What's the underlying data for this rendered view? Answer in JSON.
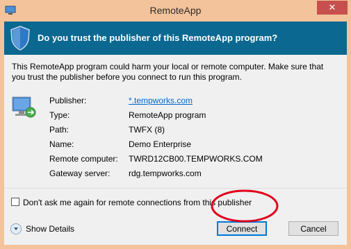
{
  "window": {
    "title": "RemoteApp",
    "close_glyph": "✕"
  },
  "banner": {
    "icon": "shield-icon",
    "text": "Do you trust the publisher of this RemoteApp program?"
  },
  "warning": "This RemoteApp program could harm your local or remote computer. Make sure that you trust the publisher before you connect to run this program.",
  "details": [
    {
      "label": "Publisher:",
      "value": "*.tempworks.com",
      "link": true
    },
    {
      "label": "Type:",
      "value": "RemoteApp program"
    },
    {
      "label": "Path:",
      "value": "TWFX (8)"
    },
    {
      "label": "Name:",
      "value": "Demo Enterprise"
    },
    {
      "label": "Remote computer:",
      "value": "TWRD12CB00.TEMPWORKS.COM"
    },
    {
      "label": "Gateway server:",
      "value": "rdg.tempworks.com"
    }
  ],
  "dont_ask": {
    "label": "Don't ask me again for remote connections from this publisher",
    "checked": false
  },
  "footer": {
    "show_details": "Show Details",
    "connect": "Connect",
    "cancel": "Cancel"
  },
  "colors": {
    "title_bar": "#f3c39b",
    "banner": "#0b6890",
    "close_button": "#c7504f",
    "annotation": "#e0001b"
  }
}
